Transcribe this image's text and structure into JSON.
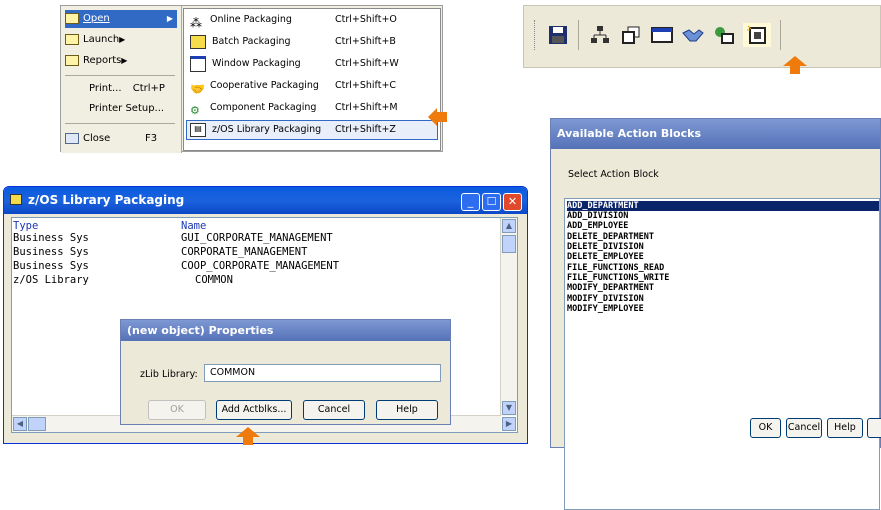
{
  "menu": {
    "items": [
      {
        "label": "Open",
        "icon": "folder-icon",
        "has_submenu": true
      },
      {
        "label": "Launch",
        "icon": "folder-icon",
        "has_submenu": true
      },
      {
        "label": "Reports",
        "icon": "folder-icon",
        "has_submenu": true
      },
      {
        "label": "Print...",
        "shortcut": "Ctrl+P"
      },
      {
        "label": "Printer Setup..."
      },
      {
        "label": "Close",
        "shortcut": "F3",
        "icon": "close-doc-icon"
      }
    ],
    "submenu": [
      {
        "label": "Online Packaging",
        "shortcut": "Ctrl+Shift+O",
        "icon": "hierarchy-icon"
      },
      {
        "label": "Batch Packaging",
        "shortcut": "Ctrl+Shift+B",
        "icon": "batch-icon"
      },
      {
        "label": "Window Packaging",
        "shortcut": "Ctrl+Shift+W",
        "icon": "window-icon"
      },
      {
        "label": "Cooperative Packaging",
        "shortcut": "Ctrl+Shift+C",
        "icon": "handshake-icon"
      },
      {
        "label": "Component Packaging",
        "shortcut": "Ctrl+Shift+M",
        "icon": "component-icon"
      },
      {
        "label": "z/OS Library Packaging",
        "shortcut": "Ctrl+Shift+Z",
        "icon": "zos-library-icon"
      }
    ]
  },
  "toolbar": {
    "buttons": [
      "save-icon",
      "hierarchy-icon",
      "batch-icon",
      "window-icon",
      "handshake-icon",
      "component-icon",
      "zos-library-icon"
    ]
  },
  "action_blocks": {
    "title": "Available Action Blocks",
    "prompt": "Select Action Block",
    "items": [
      "ADD_DEPARTMENT",
      "ADD_DIVISION",
      "ADD_EMPLOYEE",
      "DELETE_DEPARTMENT",
      "DELETE_DIVISION",
      "DELETE_EMPLOYEE",
      "FILE_FUNCTIONS_READ",
      "FILE_FUNCTIONS_WRITE",
      "MODIFY_DEPARTMENT",
      "MODIFY_DIVISION",
      "MODIFY_EMPLOYEE"
    ],
    "ok_label": "OK",
    "cancel_label": "Cancel",
    "help_label": "Help"
  },
  "zos_window": {
    "title": "z/OS Library Packaging",
    "col_type": "Type",
    "col_name": "Name",
    "rows": [
      {
        "type": "Business Sys",
        "name": "GUI_CORPORATE_MANAGEMENT"
      },
      {
        "type": "Business Sys",
        "name": "CORPORATE_MANAGEMENT"
      },
      {
        "type": "Business Sys",
        "name": "COOP_CORPORATE_MANAGEMENT"
      },
      {
        "type": "z/OS Library",
        "name": "COMMON"
      }
    ]
  },
  "properties": {
    "title": "(new object) Properties",
    "zlib_label": "zLib Library:",
    "zlib_value": "COMMON",
    "ok_label": "OK",
    "add_label": "Add Actblks...",
    "cancel_label": "Cancel",
    "help_label": "Help"
  },
  "colors": {
    "accent_arrow": "#f07b0d",
    "title_bar": "#0a5be0",
    "selection": "#0a246a"
  }
}
